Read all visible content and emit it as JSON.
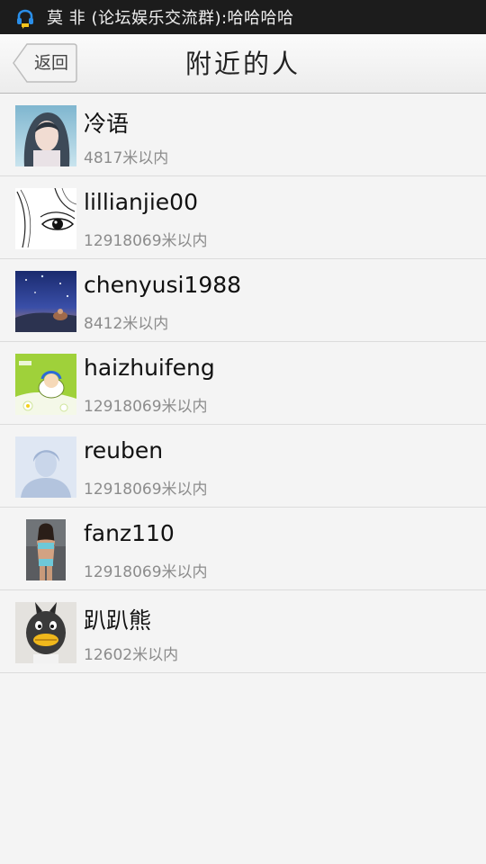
{
  "status_bar": {
    "notification_icon": "qq-penguin-chat-icon",
    "message": "莫 非 (论坛娱乐交流群):哈哈哈哈"
  },
  "header": {
    "back_label": "返回",
    "title": "附近的人"
  },
  "people": [
    {
      "name": "冷语",
      "distance": "4817米以内",
      "avatar": "avatar-blue-haired-girl"
    },
    {
      "name": "lillianjie00",
      "distance": "12918069米以内",
      "avatar": "avatar-sketch-eye"
    },
    {
      "name": "chenyusi1988",
      "distance": "8412米以内",
      "avatar": "avatar-night-sky"
    },
    {
      "name": "haizhuifeng",
      "distance": "12918069米以内",
      "avatar": "avatar-cartoon-green"
    },
    {
      "name": "reuben",
      "distance": "12918069米以内",
      "avatar": "avatar-default-silhouette"
    },
    {
      "name": "fanz110",
      "distance": "12918069米以内",
      "avatar": "avatar-woman-photo"
    },
    {
      "name": "趴趴熊",
      "distance": "12602米以内",
      "avatar": "avatar-black-cartoon"
    }
  ]
}
